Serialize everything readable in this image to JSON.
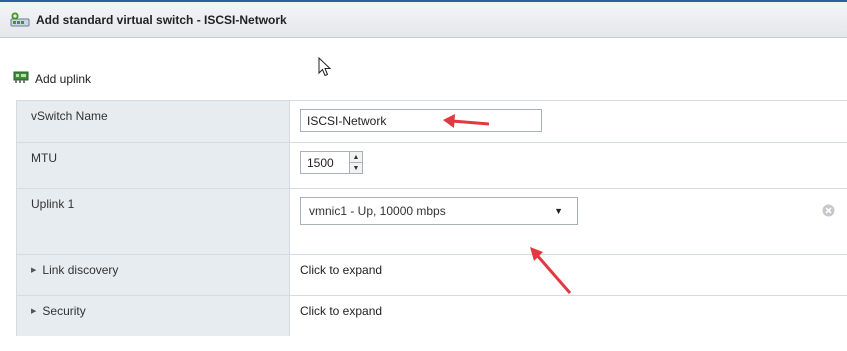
{
  "dialog": {
    "title": "Add standard virtual switch - ISCSI-Network",
    "title_icon": "virtual-switch-icon"
  },
  "toolbar": {
    "add_uplink_label": "Add uplink",
    "add_uplink_icon": "network-card-icon"
  },
  "form": {
    "vswitch_name": {
      "label": "vSwitch Name",
      "value": "ISCSI-Network"
    },
    "mtu": {
      "label": "MTU",
      "value": "1500",
      "up_glyph": "▲",
      "down_glyph": "▼"
    },
    "uplink1": {
      "label": "Uplink 1",
      "selected": "vmnic1 - Up, 10000 mbps",
      "arrow_glyph": "▼"
    },
    "link_discovery": {
      "label": "Link discovery",
      "action": "Click to expand",
      "glyph": "▶"
    },
    "security": {
      "label": "Security",
      "action": "Click to expand",
      "glyph": "▶"
    }
  },
  "colors": {
    "label_bg": "#e7ecf1",
    "border": "#d5dbe1",
    "title_accent": "#2b5fa3",
    "annotation_arrow": "#e2383f"
  }
}
